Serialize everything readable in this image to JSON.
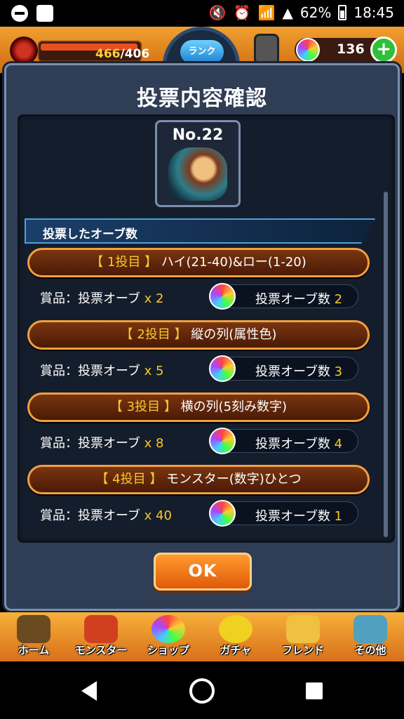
{
  "statusbar": {
    "battery": "62%",
    "time": "18:45"
  },
  "gamebar": {
    "stamina_current": "466",
    "stamina_max": "/406",
    "rank_label": "ランク",
    "orb_count": "136",
    "plus": "+"
  },
  "dialog": {
    "title": "投票内容確認",
    "quest_number": "No.22",
    "section_label": "投票したオーブ数",
    "prize_prefix": "賞品：投票オーブ",
    "count_prefix": "投票オーブ数",
    "votes": [
      {
        "num": "【 1投目 】",
        "text": "ハイ(21-40)&ロー(1-20)",
        "qty": "x 2",
        "count": "2"
      },
      {
        "num": "【 2投目 】",
        "text": "縦の列(属性色)",
        "qty": "x 5",
        "count": "3"
      },
      {
        "num": "【 3投目 】",
        "text": "横の列(5刻み数字)",
        "qty": "x 8",
        "count": "4"
      },
      {
        "num": "【 4投目 】",
        "text": "モンスター(数字)ひとつ",
        "qty": "x 40",
        "count": "1"
      }
    ],
    "ok_label": "OK"
  },
  "bottomnav": {
    "items": [
      {
        "label": "ホーム",
        "color": "#6a4a20"
      },
      {
        "label": "モンスター",
        "color": "#d04020"
      },
      {
        "label": "ショップ",
        "color": "#60c0e0"
      },
      {
        "label": "ガチャ",
        "color": "#f0d020"
      },
      {
        "label": "フレンド",
        "color": "#f0c040"
      },
      {
        "label": "その他",
        "color": "#50a0c0"
      }
    ]
  }
}
